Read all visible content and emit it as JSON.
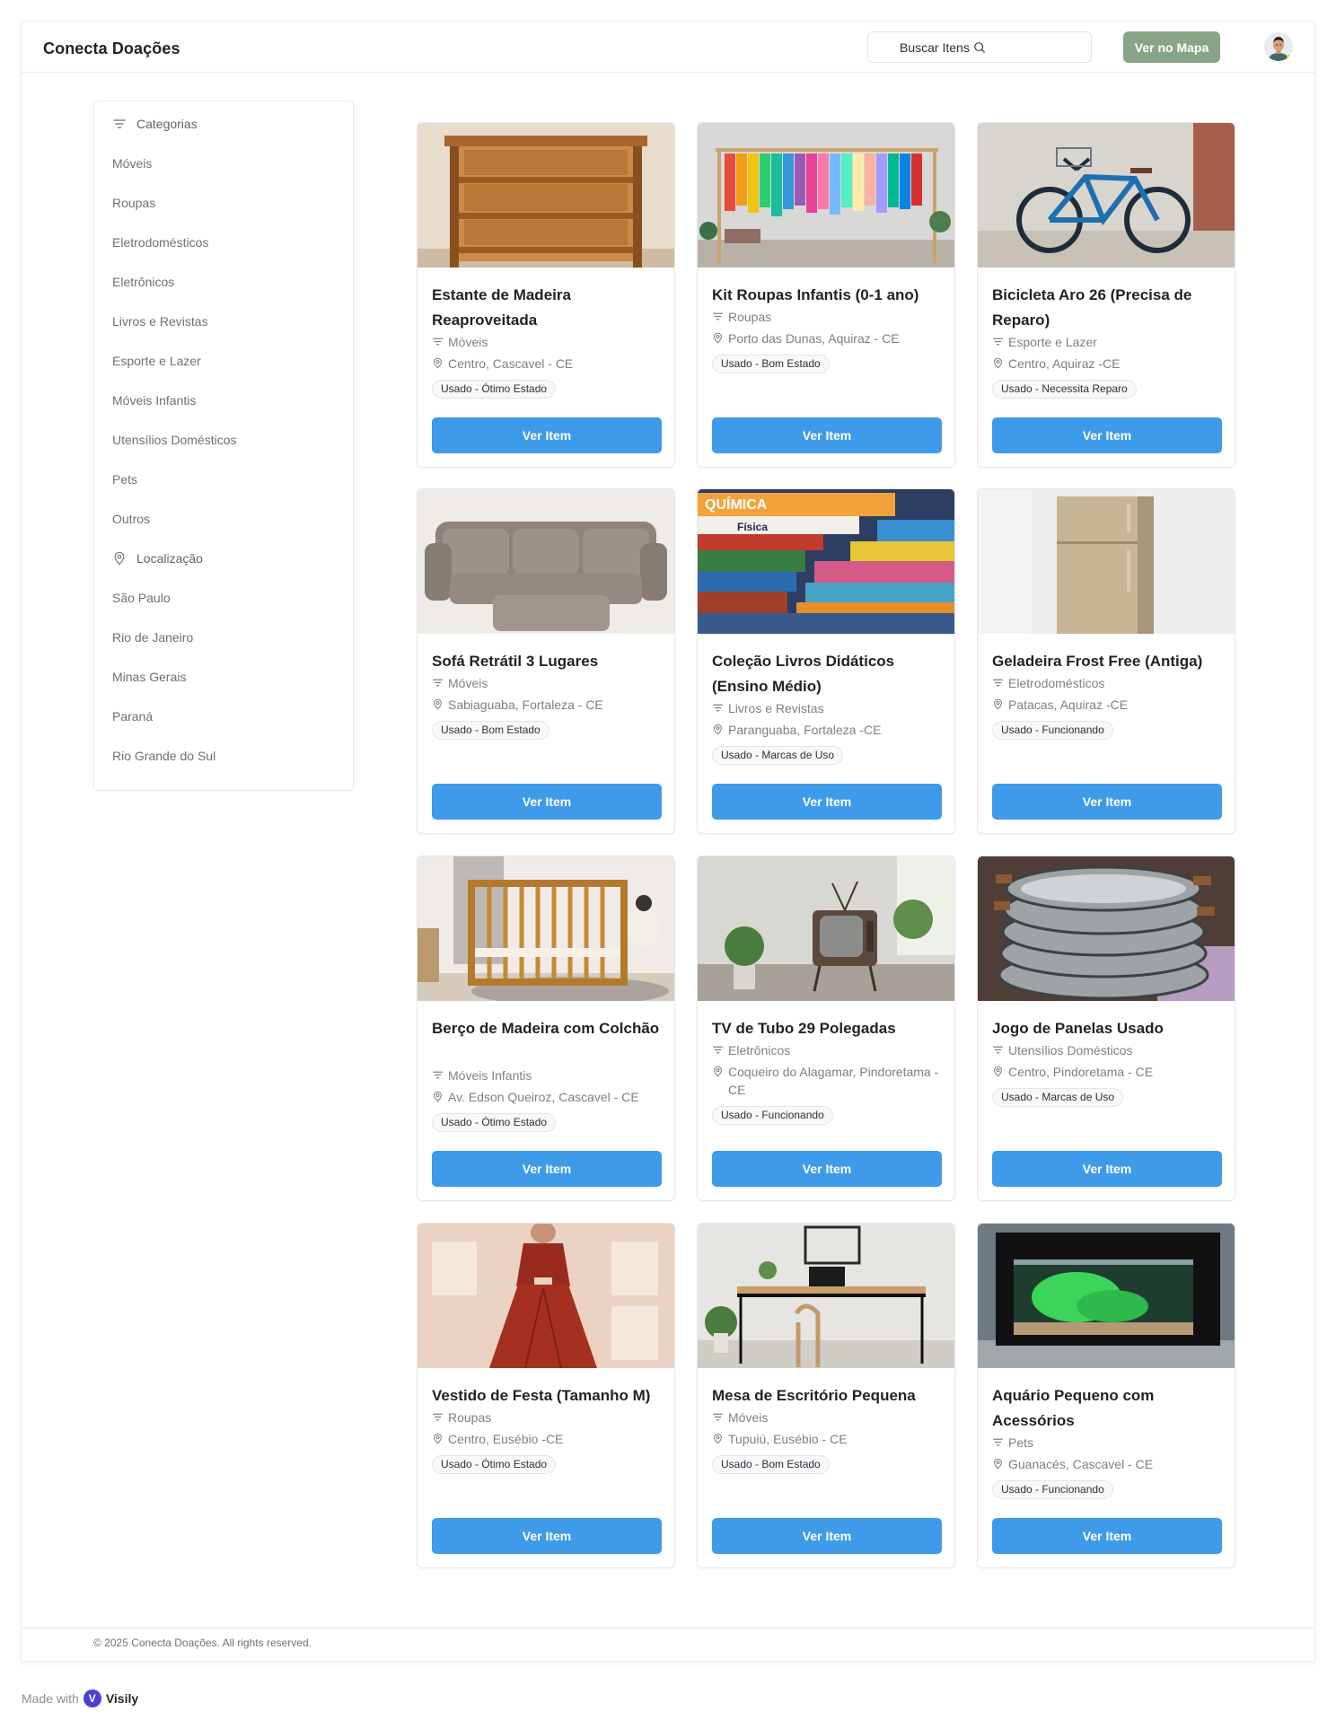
{
  "header": {
    "brand": "Conecta Doações",
    "search_label": "Buscar Itens",
    "map_button": "Ver no Mapa"
  },
  "sidebar": {
    "categories_heading": "Categorias",
    "categories": [
      "Móveis",
      "Roupas",
      "Eletrodomésticos",
      "Eletrônicos",
      "Livros e Revistas",
      "Esporte e Lazer",
      "Móveis Infantis",
      "Utensílios Domésticos",
      "Pets",
      "Outros"
    ],
    "location_heading": "Localização",
    "locations": [
      "São Paulo",
      "Rio de Janeiro",
      "Minas Gerais",
      "Paraná",
      "Rio Grande do Sul"
    ]
  },
  "items": [
    {
      "title": "Estante de Madeira Reaproveitada",
      "category": "Móveis",
      "location": "Centro, Cascavel - CE",
      "condition": "Usado - Ótimo Estado",
      "button": "Ver Item",
      "image": "shelf-photo"
    },
    {
      "title": "Kit Roupas Infantis (0-1 ano)",
      "category": "Roupas",
      "location": "Porto das Dunas, Aquiraz - CE",
      "condition": "Usado - Bom Estado",
      "button": "Ver Item",
      "image": "clothes-rack-photo"
    },
    {
      "title": "Bicicleta Aro 26 (Precisa de Reparo)",
      "category": "Esporte e Lazer",
      "location": "Centro, Aquiraz -CE",
      "condition": "Usado - Necessita Reparo",
      "button": "Ver Item",
      "image": "bicycle-photo"
    },
    {
      "title": "Sofá Retrátil 3 Lugares",
      "category": "Móveis",
      "location": "Sabiaguaba, Fortaleza - CE",
      "condition": "Usado - Bom Estado",
      "button": "Ver Item",
      "image": "sofa-photo"
    },
    {
      "title": "Coleção Livros Didáticos (Ensino Médio)",
      "category": "Livros e Revistas",
      "location": "Paranguaba, Fortaleza -CE",
      "condition": "Usado - Marcas de Uso",
      "button": "Ver Item",
      "image": "books-photo"
    },
    {
      "title": "Geladeira Frost Free (Antiga)",
      "category": "Eletrodomésticos",
      "location": "Patacas, Aquiraz -CE",
      "condition": "Usado - Funcionando",
      "button": "Ver Item",
      "image": "fridge-photo"
    },
    {
      "title": "Berço de Madeira com Colchão",
      "category": "Móveis Infantis",
      "location": "Av. Edson Queiroz, Cascavel - CE",
      "condition": "Usado - Ótimo Estado",
      "button": "Ver Item",
      "image": "crib-photo"
    },
    {
      "title": "TV de Tubo 29 Polegadas",
      "category": "Eletrônicos",
      "location": "Coqueiro do Alagamar, Pindoretama -CE",
      "condition": "Usado - Funcionando",
      "button": "Ver Item",
      "image": "tv-photo"
    },
    {
      "title": "Jogo de Panelas Usado",
      "category": "Utensílios Domésticos",
      "location": "Centro, Pindoretama - CE",
      "condition": "Usado - Marcas de Uso",
      "button": "Ver Item",
      "image": "pans-photo"
    },
    {
      "title": "Vestido de Festa (Tamanho M)",
      "category": "Roupas",
      "location": "Centro, Eusébio -CE",
      "condition": "Usado - Ótimo Estado",
      "button": "Ver Item",
      "image": "dress-photo"
    },
    {
      "title": "Mesa de Escritório Pequena",
      "category": "Móveis",
      "location": "Tupuiú, Eusébio - CE",
      "condition": "Usado - Bom Estado",
      "button": "Ver Item",
      "image": "desk-photo"
    },
    {
      "title": "Aquário Pequeno com Acessórios",
      "category": "Pets",
      "location": "Guanacés, Cascavel - CE",
      "condition": "Usado - Funcionando",
      "button": "Ver Item",
      "image": "aquarium-photo"
    }
  ],
  "footer": {
    "copyright": "© 2025 Conecta Doações. All rights reserved.",
    "made_with": "Made with",
    "made_with_brand": "Visily"
  },
  "colors": {
    "primary_button": "#3e9be9",
    "map_button": "#87a486",
    "text": "#1f2328",
    "muted": "#7a8087"
  },
  "icons": {
    "search": "search-icon",
    "filter": "filter-icon",
    "location": "map-pin-icon"
  }
}
